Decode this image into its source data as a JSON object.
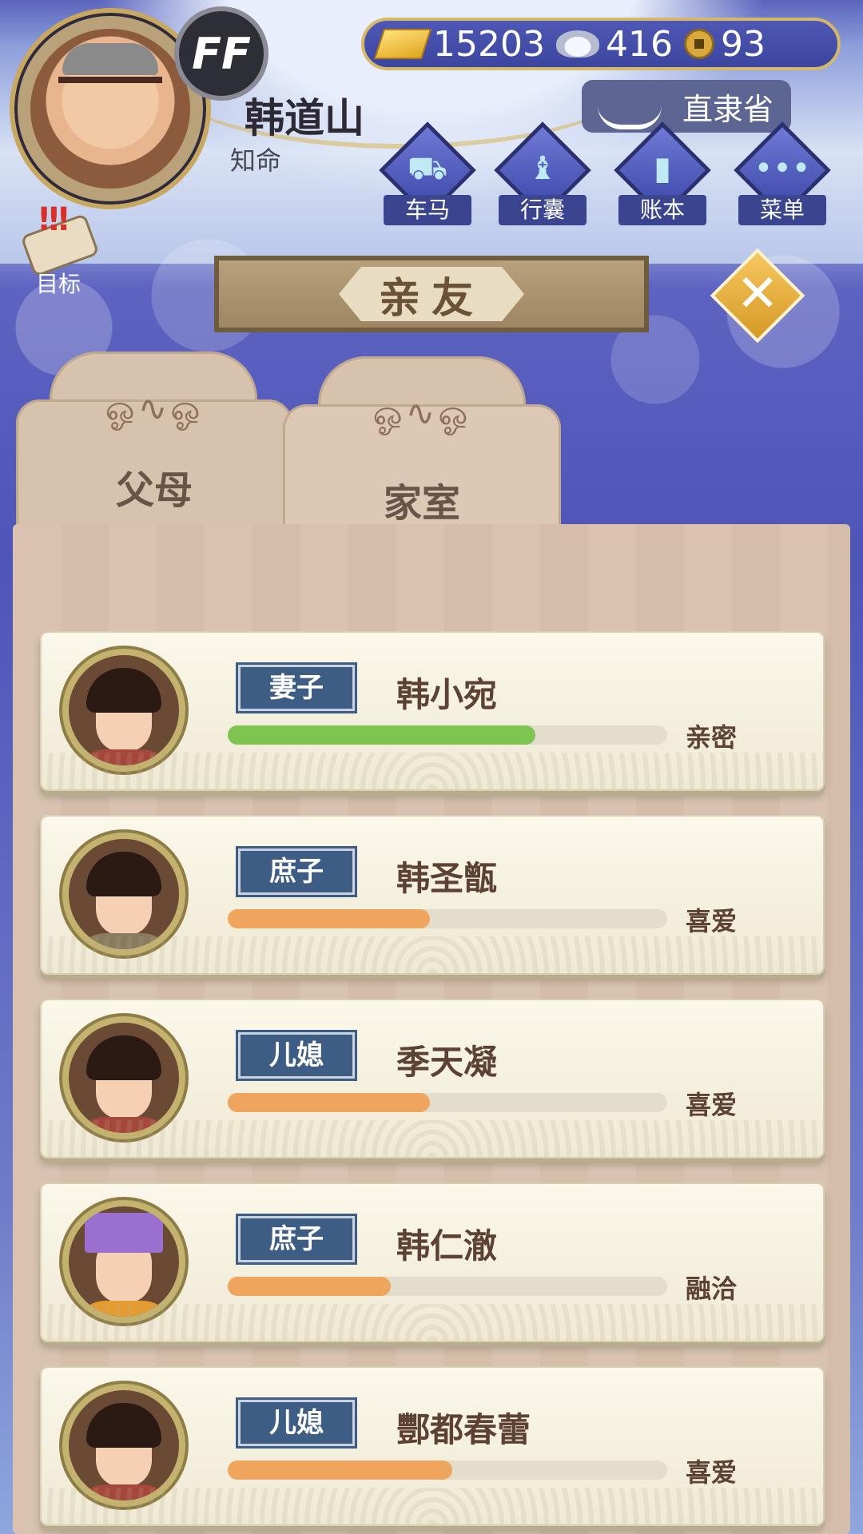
{
  "player": {
    "name": "韩道山",
    "title": "知命",
    "badge": "FF"
  },
  "currency": {
    "gold": "15203",
    "silver": "416",
    "coins": "93",
    "icons": [
      "gold-ingot-icon",
      "silver-ingot-icon",
      "copper-coin-icon"
    ]
  },
  "location": "直隶省",
  "nav": [
    {
      "label": "车马",
      "icon": "carriage-icon",
      "glyph": "⛟"
    },
    {
      "label": "行囊",
      "icon": "bundle-icon",
      "glyph": "♝"
    },
    {
      "label": "账本",
      "icon": "ledger-icon",
      "glyph": "▮"
    },
    {
      "label": "菜单",
      "icon": "menu-icon",
      "glyph": "•••"
    }
  ],
  "goal_label": "目标",
  "header_title": "亲友",
  "tabs": [
    {
      "label": "父母",
      "active": false
    },
    {
      "label": "家室",
      "active": true
    }
  ],
  "colors": {
    "bar_green": "#7ec450",
    "bar_orange": "#f0a55e",
    "badge_blue": "#3e5d84"
  },
  "members": [
    {
      "role": "妻子",
      "name": "韩小宛",
      "relation": "亲密",
      "affinity": 0.7,
      "bar_color": "#7ec450",
      "portrait": "woman"
    },
    {
      "role": "庶子",
      "name": "韩圣甑",
      "relation": "喜爱",
      "affinity": 0.46,
      "bar_color": "#f0a55e",
      "portrait": "boy"
    },
    {
      "role": "儿媳",
      "name": "季天凝",
      "relation": "喜爱",
      "affinity": 0.46,
      "bar_color": "#f0a55e",
      "portrait": "woman"
    },
    {
      "role": "庶子",
      "name": "韩仁澈",
      "relation": "融洽",
      "affinity": 0.37,
      "bar_color": "#f0a55e",
      "portrait": "official"
    },
    {
      "role": "儿媳",
      "name": "酆都春蕾",
      "relation": "喜爱",
      "affinity": 0.51,
      "bar_color": "#f0a55e",
      "portrait": "woman"
    }
  ]
}
